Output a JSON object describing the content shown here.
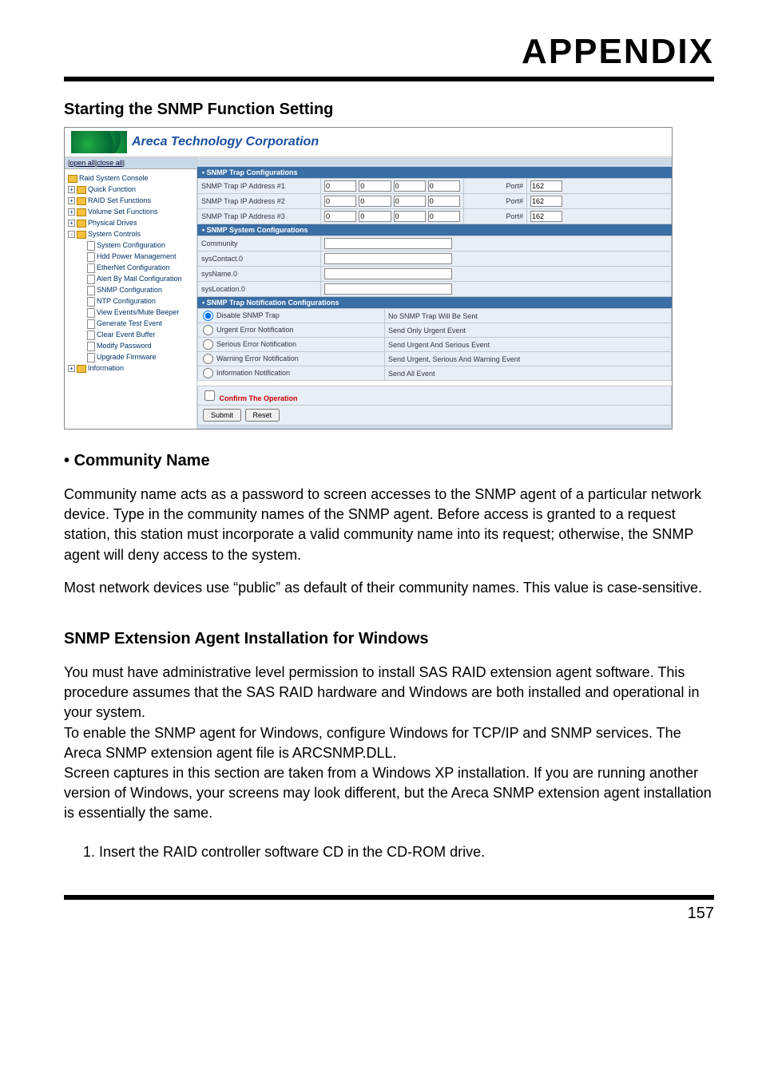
{
  "header": {
    "title": "APPENDIX"
  },
  "section": {
    "title": "Starting the SNMP Function Setting"
  },
  "screenshot": {
    "corp_title": "Areca Technology Corporation",
    "nav": {
      "open": "open all",
      "close": "close all",
      "root": "Raid System Console",
      "quick": "Quick Function",
      "raidset": "RAID Set Functions",
      "volset": "Volume Set Functions",
      "physical": "Physical Drives",
      "sysctrl": "System Controls",
      "sysconf": "System Configuration",
      "hdd": "Hdd Power Management",
      "eth": "EtherNet Configuration",
      "alert": "Alert By Mail Configuration",
      "snmp": "SNMP Configuration",
      "ntp": "NTP Configuration",
      "view": "View Events/Mute Beeper",
      "gen": "Generate Test Event",
      "clear": "Clear Event Buffer",
      "modify": "Modify Password",
      "upgrade": "Upgrade Firmware",
      "info": "Information"
    },
    "sections": {
      "trap": "• SNMP Trap Configurations",
      "sys": "• SNMP System Configurations",
      "notif": "• SNMP Trap Notification Configurations"
    },
    "trap_rows": [
      {
        "label": "SNMP Trap IP Address #1",
        "ip": [
          "0",
          "0",
          "0",
          "0"
        ],
        "portlabel": "Port#",
        "port": "162"
      },
      {
        "label": "SNMP Trap IP Address #2",
        "ip": [
          "0",
          "0",
          "0",
          "0"
        ],
        "portlabel": "Port#",
        "port": "162"
      },
      {
        "label": "SNMP Trap IP Address #3",
        "ip": [
          "0",
          "0",
          "0",
          "0"
        ],
        "portlabel": "Port#",
        "port": "162"
      }
    ],
    "sys_rows": [
      {
        "label": "Community",
        "value": ""
      },
      {
        "label": "sysContact.0",
        "value": ""
      },
      {
        "label": "sysName.0",
        "value": ""
      },
      {
        "label": "sysLocation.0",
        "value": ""
      }
    ],
    "notif_rows": [
      {
        "label": "Disable SNMP Trap",
        "desc": "No SNMP Trap Will Be Sent",
        "checked": true
      },
      {
        "label": "Urgent Error Notification",
        "desc": "Send Only Urgent Event",
        "checked": false
      },
      {
        "label": "Serious Error Notification",
        "desc": "Send Urgent And Serious Event",
        "checked": false
      },
      {
        "label": "Warning Error Notification",
        "desc": "Send Urgent, Serious And Warning Event",
        "checked": false
      },
      {
        "label": "Information Notification",
        "desc": "Send All Event",
        "checked": false
      }
    ],
    "confirm": "Confirm The Operation",
    "submit": "Submit",
    "reset": "Reset"
  },
  "community": {
    "title": "Community Name",
    "p1": "Community name acts as a password to screen accesses to the SNMP agent of a particular network device.  Type in the community names of the SNMP agent. Before access is granted to a request station, this station must incorporate a valid community name into its request; otherwise, the SNMP agent will deny access to the system.",
    "p2": "Most network devices use “public” as default of their community names. This value is case-sensitive."
  },
  "agent": {
    "title": "SNMP Extension Agent Installation for Windows",
    "p1": "You must have administrative level permission to install SAS RAID extension agent software. This procedure assumes that the SAS RAID hardware and Windows are both installed and operational in your system.",
    "p2": "To enable the SNMP agent for Windows, configure Windows for TCP/IP and SNMP services. The Areca SNMP extension agent file is ARCSNMP.DLL.",
    "p3": "Screen captures in this section are taken from a Windows XP installation. If you are running another version of Windows, your screens may look different, but the Areca SNMP extension agent installation is essentially the same.",
    "li1": "1. Insert the RAID controller software CD in the CD-ROM drive."
  },
  "footer": {
    "page": "157"
  }
}
